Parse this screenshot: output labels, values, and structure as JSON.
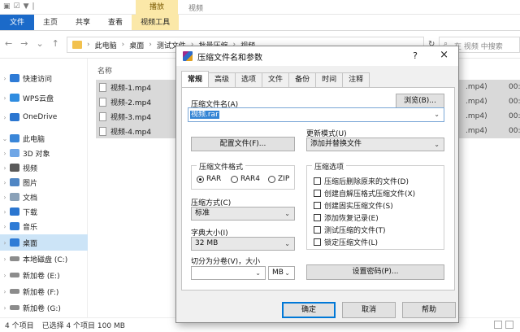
{
  "ribbon": {
    "quick_access": [
      "▣",
      "☑",
      "▼",
      "|"
    ],
    "context_group": "播放",
    "window_title": "视频",
    "tabs": [
      "文件",
      "主页",
      "共享",
      "查看",
      "视频工具"
    ]
  },
  "address": {
    "crumbs": [
      "此电脑",
      "桌面",
      "测试文件",
      "批量压缩",
      "视频"
    ],
    "search_placeholder": "在 视频 中搜索"
  },
  "nav_pane": {
    "items": [
      {
        "label": "快速访问",
        "icon_color": "#2e7bd6"
      },
      {
        "label": "WPS云盘",
        "icon_color": "#2f8ce0"
      },
      {
        "label": "OneDrive",
        "icon_color": "#2b76d0"
      },
      {
        "label": "此电脑",
        "icon_color": "#3a86d8"
      },
      {
        "label": "3D 对象",
        "icon_color": "#6fa6e6"
      },
      {
        "label": "视频",
        "icon_color": "#5a5a5a"
      },
      {
        "label": "图片",
        "icon_color": "#4f86c4"
      },
      {
        "label": "文档",
        "icon_color": "#8aa1b8"
      },
      {
        "label": "下载",
        "icon_color": "#2b76d0"
      },
      {
        "label": "音乐",
        "icon_color": "#2e7bd6"
      },
      {
        "label": "桌面",
        "icon_color": "#2e7bd6"
      },
      {
        "label": "本地磁盘 (C:)",
        "icon_color": "#8c8c8c"
      },
      {
        "label": "新加卷 (E:)",
        "icon_color": "#8c8c8c"
      },
      {
        "label": "新加卷 (F:)",
        "icon_color": "#8c8c8c"
      },
      {
        "label": "新加卷 (G:)",
        "icon_color": "#8c8c8c"
      }
    ]
  },
  "file_list": {
    "column_name": "名称",
    "files": [
      "视频-1.mp4",
      "视频-2.mp4",
      "视频-3.mp4",
      "视频-4.mp4"
    ],
    "right_type": ".mp4)",
    "right_date": "00:"
  },
  "status_bar": {
    "count": "4 个项目",
    "selected": "已选择 4 个项目 100 MB"
  },
  "dialog": {
    "title": "压缩文件名和参数",
    "help": "?",
    "close": "×",
    "tabs": [
      "常规",
      "高级",
      "选项",
      "文件",
      "备份",
      "时间",
      "注释"
    ],
    "archive_name_label": "压缩文件名(A)",
    "browse_button": "浏览(B)...",
    "archive_name_value": "视频.rar",
    "profiles_button": "配置文件(F)...",
    "update_mode_label": "更新模式(U)",
    "update_mode_value": "添加并替换文件",
    "format_group": "压缩文件格式",
    "format_options": [
      "RAR",
      "RAR4",
      "ZIP"
    ],
    "method_label": "压缩方式(C)",
    "method_value": "标准",
    "dict_label": "字典大小(I)",
    "dict_value": "32 MB",
    "split_label": "切分为分卷(V)，大小",
    "split_unit": "MB",
    "options_group": "压缩选项",
    "options": [
      "压缩后删除原来的文件(D)",
      "创建自解压格式压缩文件(X)",
      "创建固实压缩文件(S)",
      "添加恢复记录(E)",
      "测试压缩的文件(T)",
      "锁定压缩文件(L)"
    ],
    "password_button": "设置密码(P)...",
    "ok_button": "确定",
    "cancel_button": "取消",
    "help_button": "帮助"
  }
}
